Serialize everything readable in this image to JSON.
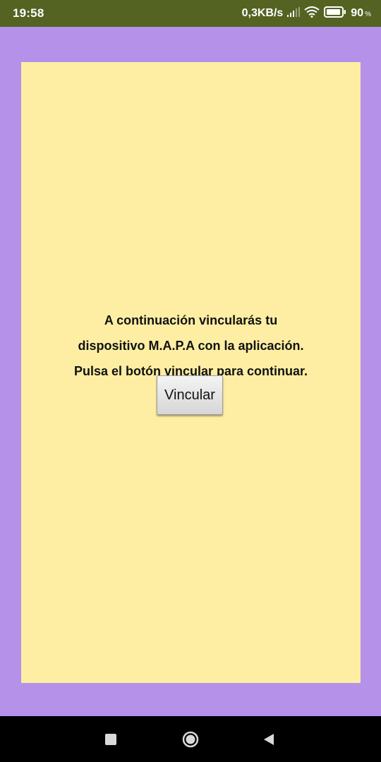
{
  "status_bar": {
    "time": "19:58",
    "net_speed": "0,3KB/s",
    "battery_level": "90",
    "battery_unit": "%",
    "icons": [
      "signal-icon",
      "wifi-icon",
      "battery-icon"
    ]
  },
  "colors": {
    "status_bar": "#546222",
    "background": "#b591e9",
    "panel": "#fdeea3",
    "nav_bar": "#000000"
  },
  "main": {
    "message_lines": [
      "A continuación vincularás tu",
      "dispositivo M.A.P.A con la aplicación.",
      "Pulsa el botón vincular para continuar."
    ],
    "button_label": "Vincular"
  },
  "nav_bar": {
    "icons": [
      "recents-icon",
      "home-icon",
      "back-icon"
    ]
  }
}
